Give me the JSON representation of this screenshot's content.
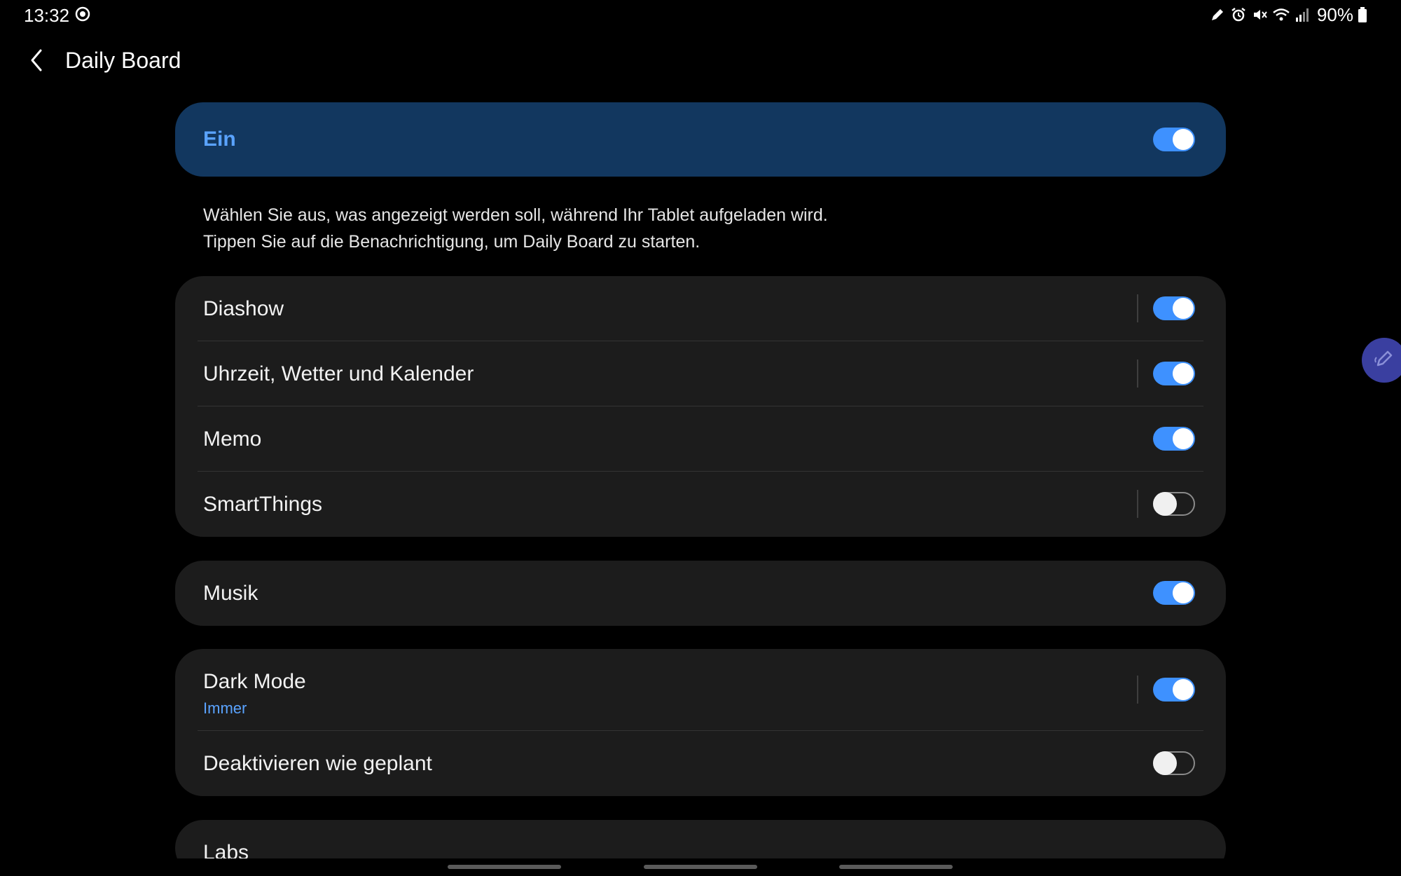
{
  "status_bar": {
    "time": "13:32",
    "battery": "90%",
    "icons": [
      "record-icon",
      "pen-icon",
      "alarm-icon",
      "mute-icon",
      "wifi-icon",
      "signal-icon",
      "battery-icon"
    ]
  },
  "app_bar": {
    "title": "Daily Board",
    "back_icon": "back-arrow-icon"
  },
  "master": {
    "label": "Ein",
    "enabled": true
  },
  "description": {
    "line1": "Wählen Sie aus, was angezeigt werden soll, während Ihr Tablet aufgeladen wird.",
    "line2": "Tippen Sie auf die Benachrichtigung, um Daily Board zu starten."
  },
  "group1": {
    "items": [
      {
        "label": "Diashow",
        "enabled": true
      },
      {
        "label": "Uhrzeit, Wetter und Kalender",
        "enabled": true
      },
      {
        "label": "Memo",
        "enabled": true
      },
      {
        "label": "SmartThings",
        "enabled": false
      }
    ]
  },
  "group2": {
    "items": [
      {
        "label": "Musik",
        "enabled": true
      }
    ]
  },
  "group3": {
    "items": [
      {
        "label": "Dark Mode",
        "sublabel": "Immer",
        "enabled": true
      },
      {
        "label": "Deaktivieren wie geplant",
        "enabled": false
      }
    ]
  },
  "group4": {
    "items": [
      {
        "label": "Labs"
      }
    ]
  },
  "colors": {
    "accent": "#3e91ff",
    "master_bg": "#12375f",
    "card_bg": "#1c1c1c"
  }
}
